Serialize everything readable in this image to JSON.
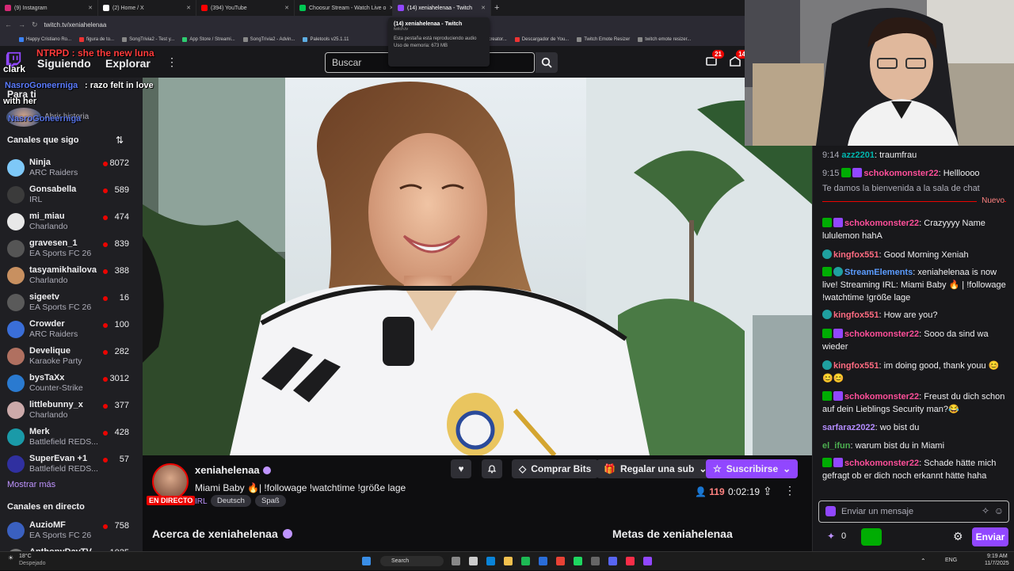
{
  "browser": {
    "tabs": [
      {
        "label": "(9) Instagram",
        "color": "#d62976"
      },
      {
        "label": "(2) Home / X",
        "color": "#ffffff"
      },
      {
        "label": "(394) YouTube",
        "color": "#ff0000"
      },
      {
        "label": "Choosur Stream - Watch Live o",
        "color": "#00c853"
      },
      {
        "label": "(14) xeniahelenaa - Twitch",
        "color": "#9147ff",
        "active": true
      }
    ],
    "url": "twitch.tv/xeniahelenaa",
    "bookmarks": [
      "Happy Cristiano Ro...",
      "figura de to...",
      "SongTrivia2 - Test y...",
      "App Store / Streami...",
      "SongTrivia2 - Advin...",
      "Paletools v25.1.11",
      "FIFA 23 Card creator...",
      "Descargador de You...",
      "Twitch Emote Resizer",
      "twitch emote resizer..."
    ],
    "tooltip": {
      "title": "(14) xeniahelenaa - Twitch",
      "domain": "twitch.tv",
      "line1": "Esta pestaña está reproduciendo audio",
      "line2": "Uso de memoria: 673 MB"
    }
  },
  "header": {
    "nav_following": "Siguiendo",
    "nav_explore": "Explorar",
    "search_placeholder": "Buscar",
    "notif_count": "21",
    "inbox_count": "14"
  },
  "overlay": {
    "line1": "NTRPD : she the new luna",
    "line1_user": "clark",
    "line2_user": "NasroGoneerniga",
    "line2_text": ": razo felt in love",
    "line3": "with her",
    "line4_user": "NasroGoneerniga"
  },
  "sidebar": {
    "for_you": "Para ti",
    "story": "Abrir historia",
    "followed_title": "Canales que sigo",
    "channels": [
      {
        "name": "Ninja",
        "game": "ARC Raiders",
        "viewers": "8072",
        "color": "#7ec8f7"
      },
      {
        "name": "Gonsabella",
        "game": "IRL",
        "viewers": "589",
        "color": "#3b3b3b"
      },
      {
        "name": "mi_miau",
        "game": "Charlando",
        "viewers": "474",
        "color": "#e8e8e8"
      },
      {
        "name": "gravesen_1",
        "game": "EA Sports FC 26",
        "viewers": "839",
        "color": "#555"
      },
      {
        "name": "tasyamikhailova",
        "game": "Charlando",
        "viewers": "388",
        "color": "#c89060"
      },
      {
        "name": "sigeetv",
        "game": "EA Sports FC 26",
        "viewers": "16",
        "color": "#5a5a5a"
      },
      {
        "name": "Crowder",
        "game": "ARC Raiders",
        "viewers": "100",
        "color": "#3a6ed8"
      },
      {
        "name": "Develique",
        "game": "Karaoke Party",
        "viewers": "282",
        "color": "#b07060"
      },
      {
        "name": "bysTaXx",
        "game": "Counter-Strike",
        "viewers": "3012",
        "color": "#2a7ad0"
      },
      {
        "name": "littlebunny_x",
        "game": "Charlando",
        "viewers": "377",
        "color": "#caa"
      },
      {
        "name": "Merk",
        "game": "Battlefield REDS...",
        "viewers": "428",
        "color": "#1a9aa8"
      },
      {
        "name": "SuperEvan +1",
        "game": "Battlefield REDS...",
        "viewers": "57",
        "color": "#3030a0"
      }
    ],
    "show_more": "Mostrar más",
    "live_title": "Canales en directo",
    "live_channels": [
      {
        "name": "AuzioMF",
        "game": "EA Sports FC 26",
        "viewers": "758",
        "color": "#3a60c0"
      },
      {
        "name": "AnthonyDavTV",
        "game": "",
        "viewers": "1025",
        "color": "#777"
      }
    ]
  },
  "stream": {
    "streamer": "xeniahelenaa",
    "live_badge": "EN DIRECTO",
    "title": "Miami Baby 🔥| !followage !watchtime !größe lage",
    "category": "IRL",
    "tags": [
      "Deutsch",
      "Spaß"
    ],
    "buy_bits": "Comprar Bits",
    "gift_sub": "Regalar una sub",
    "subscribe": "Suscribirse",
    "viewers": "119",
    "uptime": "0:02:19",
    "about": "Acerca de xeniahelenaa",
    "goals": "Metas de xeniahelenaa"
  },
  "chat": {
    "messages": [
      {
        "time": "9:14",
        "user": "azz2201",
        "color": "#00b5ad",
        "text": ": traumfrau",
        "badges": []
      },
      {
        "time": "9:15",
        "user": "schokomonster22",
        "color": "#ff4f9a",
        "text": ": Hellloooo",
        "badges": [
          "g",
          "p"
        ]
      },
      {
        "system": "Te damos la bienvenida a la sala de chat"
      },
      {
        "user": "schokomonster22",
        "color": "#ff4f9a",
        "text": ": Crazyyyy Name lululemon hahA",
        "badges": [
          "g",
          "p"
        ]
      },
      {
        "user": "kingfox551",
        "color": "#ff6b81",
        "text": ": Good Morning Xeniah",
        "badges": [
          "c"
        ]
      },
      {
        "user": "StreamElements",
        "color": "#5b9cff",
        "text": ": xeniahelenaa is now live! Streaming IRL: Miami Baby 🔥 | !followage !watchtime !größe lage",
        "badges": [
          "g",
          "c"
        ]
      },
      {
        "user": "kingfox551",
        "color": "#ff6b81",
        "text": ": How are you?",
        "badges": [
          "c"
        ]
      },
      {
        "user": "schokomonster22",
        "color": "#ff4f9a",
        "text": ": Sooo da sind wa wieder",
        "badges": [
          "g",
          "p"
        ]
      },
      {
        "user": "kingfox551",
        "color": "#ff6b81",
        "text": ": im doing good, thank youu 😊😊😊",
        "badges": [
          "c"
        ]
      },
      {
        "user": "schokomonster22",
        "color": "#ff4f9a",
        "text": ": Freust du dich schon auf dein Lieblings Security man?😂",
        "badges": [
          "g",
          "p"
        ]
      },
      {
        "user": "sarfaraz2022",
        "color": "#b38cff",
        "text": ": wo bist du",
        "badges": []
      },
      {
        "user": "el_ifun",
        "color": "#4caf50",
        "text": ": warum bist du in Miami",
        "badges": []
      },
      {
        "user": "schokomonster22",
        "color": "#ff4f9a",
        "text": ": Schade hätte mich gefragt ob er dich noch erkannt hätte haha",
        "badges": [
          "g",
          "p"
        ]
      }
    ],
    "new_label": "Nuevo",
    "placeholder": "Enviar un mensaje",
    "points": "0",
    "send": "Enviar"
  },
  "taskbar": {
    "weather": "18°C",
    "weather_desc": "Despejado",
    "search": "Search",
    "lang": "ENG",
    "time": "9:19 AM",
    "date": "11/7/2025"
  }
}
